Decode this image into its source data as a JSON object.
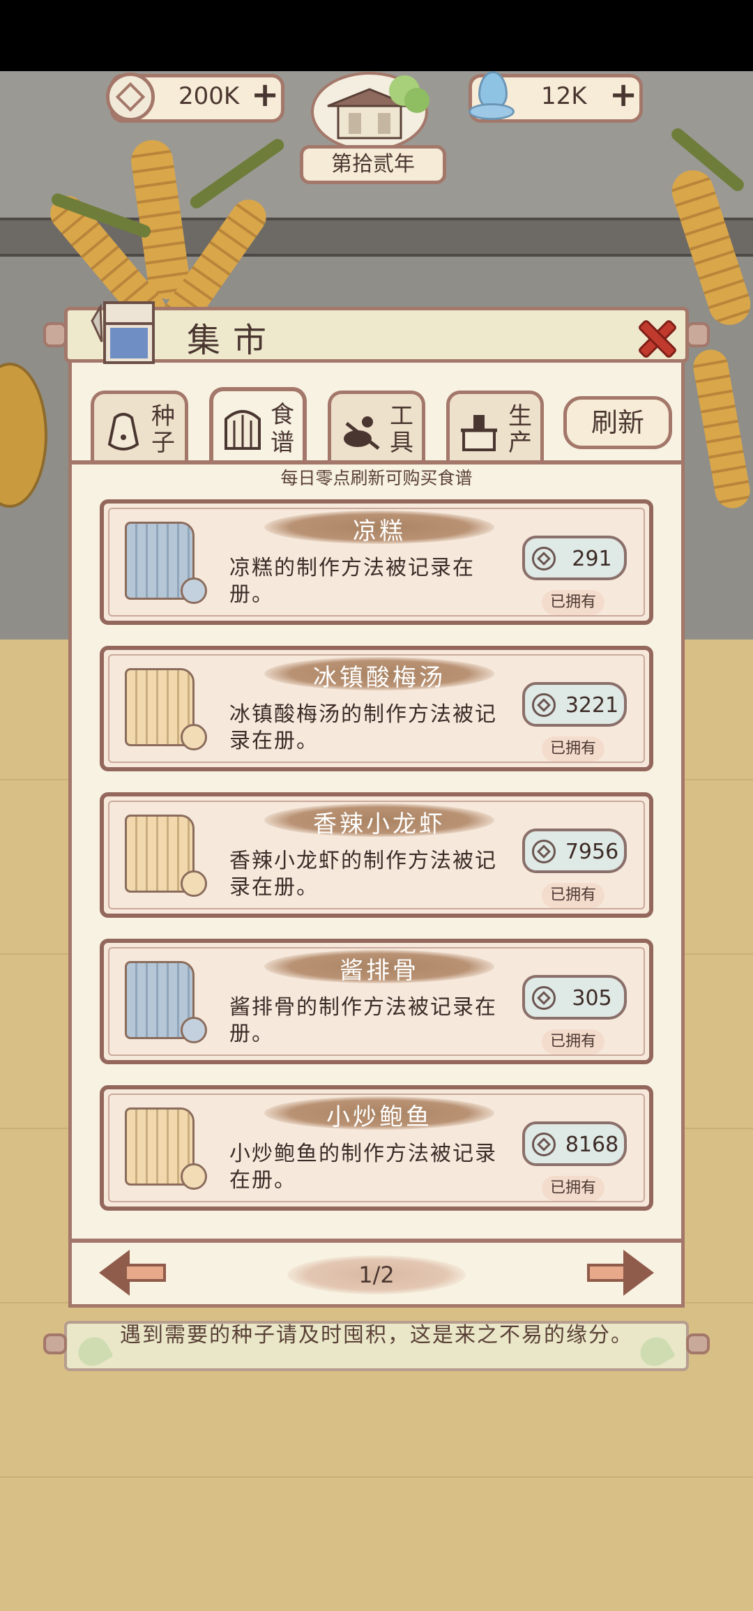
{
  "hud": {
    "coins": "200K",
    "water": "12K",
    "year": "第拾贰年"
  },
  "panel": {
    "title": "集市",
    "tabs": [
      {
        "line1": "种",
        "line2": "子"
      },
      {
        "line1": "食",
        "line2": "谱"
      },
      {
        "line1": "工",
        "line2": "具"
      },
      {
        "line1": "生",
        "line2": "产"
      }
    ],
    "refresh_label": "刷新",
    "hint": "每日零点刷新可购买食谱"
  },
  "recipes": [
    {
      "name": "凉糕",
      "desc": "凉糕的制作方法被记录在册。",
      "price": "291",
      "status": "已拥有",
      "scroll_color": "blue"
    },
    {
      "name": "冰镇酸梅汤",
      "desc": "冰镇酸梅汤的制作方法被记录在册。",
      "price": "3221",
      "status": "已拥有",
      "scroll_color": "tan"
    },
    {
      "name": "香辣小龙虾",
      "desc": "香辣小龙虾的制作方法被记录在册。",
      "price": "7956",
      "status": "已拥有",
      "scroll_color": "tan"
    },
    {
      "name": "酱排骨",
      "desc": "酱排骨的制作方法被记录在册。",
      "price": "305",
      "status": "已拥有",
      "scroll_color": "blue"
    },
    {
      "name": "小炒鲍鱼",
      "desc": "小炒鲍鱼的制作方法被记录在册。",
      "price": "8168",
      "status": "已拥有",
      "scroll_color": "tan"
    }
  ],
  "pagination": {
    "page": "1/2"
  },
  "tip": "遇到需要的种子请及时囤积，这是来之不易的缘分。",
  "colors": {
    "frame": "#a37769",
    "panel_bg": "#f8f2e2",
    "card_bg": "#f6e9dc",
    "close": "#c13a2e"
  }
}
